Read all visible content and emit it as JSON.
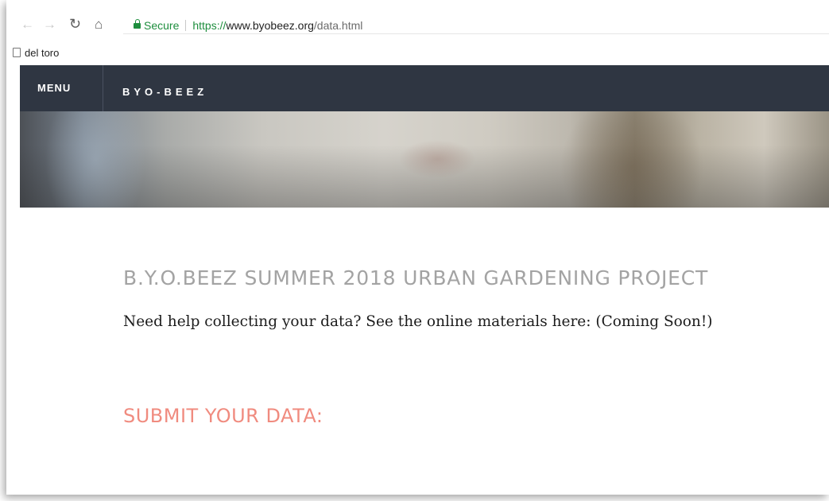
{
  "browser": {
    "nav_icons": [
      "back-arrow-icon",
      "forward-arrow-icon",
      "reload-icon",
      "home-icon"
    ],
    "address": {
      "secure_label": "Secure",
      "url_scheme": "https://",
      "url_host": "www.byobeez.org",
      "url_path": "/data.html"
    },
    "bookmarks": [
      {
        "label": "del toro",
        "icon": "page-icon"
      }
    ]
  },
  "site": {
    "menu_label": "MENU",
    "brand": "BYO-BEEZ",
    "nav_color": "#2f3642"
  },
  "main": {
    "title": "B.Y.O.BEEZ SUMMER 2018 URBAN GARDENING PROJECT",
    "help_text": "Need help collecting your data? See the online materials here: (Coming Soon!)",
    "submit_heading": "SUBMIT YOUR DATA:",
    "title_color": "#a3a3a3",
    "accent_color": "#f08b7f"
  }
}
